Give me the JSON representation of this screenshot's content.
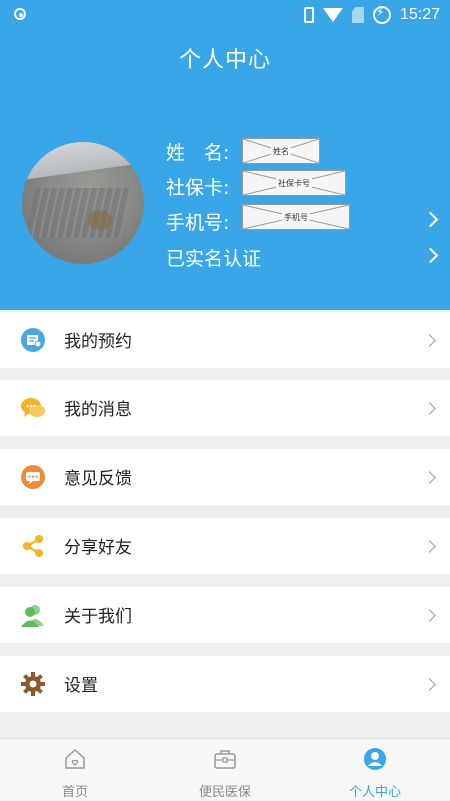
{
  "status_bar": {
    "time": "15:27"
  },
  "header": {
    "title": "个人中心",
    "name_label": "姓　名:",
    "name_placeholder": "姓名",
    "card_label": "社保卡:",
    "card_placeholder": "社保卡号",
    "phone_label": "手机号:",
    "phone_placeholder": "手机号",
    "verified_label": "已实名认证"
  },
  "menu": {
    "items": [
      {
        "label": "我的预约",
        "icon": "calendar-icon",
        "color": "#4aa8e0"
      },
      {
        "label": "我的消息",
        "icon": "chat-bubbles-icon",
        "color": "#f5b325"
      },
      {
        "label": "意见反馈",
        "icon": "feedback-icon",
        "color": "#f08a3a"
      },
      {
        "label": "分享好友",
        "icon": "share-icon",
        "color": "#f5b325"
      },
      {
        "label": "关于我们",
        "icon": "people-icon",
        "color": "#5dbb5d"
      },
      {
        "label": "设置",
        "icon": "gear-icon",
        "color": "#8a5a2c"
      }
    ]
  },
  "bottom_nav": {
    "items": [
      {
        "label": "首页",
        "icon": "home-icon"
      },
      {
        "label": "便民医保",
        "icon": "briefcase-icon"
      },
      {
        "label": "个人中心",
        "icon": "person-icon",
        "active": true
      }
    ]
  },
  "colors": {
    "primary": "#39a6e8",
    "background": "#eeeeee"
  }
}
